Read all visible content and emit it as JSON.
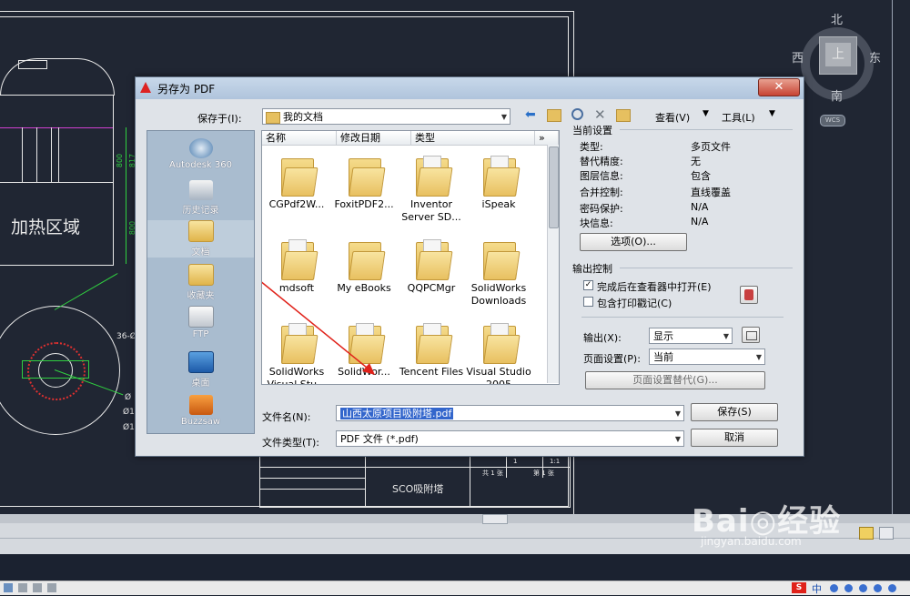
{
  "cad": {
    "heating_zone_label": "加热区域",
    "title_block_text": "SCO吸附塔",
    "dim_labels": [
      "800",
      "817",
      "800"
    ],
    "side_labels": [
      "36-Ø",
      "Ø",
      "Ø1",
      "Ø1"
    ],
    "tb_small": [
      "1",
      "1:1",
      "共 1 张",
      "第 1 张"
    ]
  },
  "compass": {
    "north": "北",
    "south": "南",
    "east": "东",
    "west": "西",
    "center": "上",
    "wcs": "WCS"
  },
  "dialog": {
    "title": "另存为 PDF",
    "close_label": "✕",
    "save_in_label": "保存于(I):",
    "save_in_value": "我的文档",
    "view_label": "查看(V)",
    "tools_label": "工具(L)",
    "columns": [
      "名称",
      "修改日期",
      "类型"
    ],
    "places": [
      "Autodesk 360",
      "历史记录",
      "文档",
      "收藏夹",
      "FTP",
      "桌面",
      "Buzzsaw"
    ],
    "files": [
      "CGPdf2W...",
      "FoxitPDF2...",
      "Inventor Server SD...",
      "iSpeak",
      "mdsoft",
      "My eBooks",
      "QQPCMgr",
      "SolidWorks Downloads",
      "SolidWorks Visual Stu...",
      "SolidWor...",
      "Tencent Files",
      "Visual Studio 2005"
    ],
    "filename_label": "文件名(N):",
    "filename_value": "山西太原项目吸附塔.pdf",
    "filetype_label": "文件类型(T):",
    "filetype_value": "PDF 文件 (*.pdf)",
    "save_button": "保存(S)",
    "cancel_button": "取消",
    "current_settings_title": "当前设置",
    "settings": [
      {
        "key": "类型:",
        "value": "多页文件"
      },
      {
        "key": "替代精度:",
        "value": "无"
      },
      {
        "key": "图层信息:",
        "value": "包含"
      },
      {
        "key": "合并控制:",
        "value": "直线覆盖"
      },
      {
        "key": "密码保护:",
        "value": "N/A"
      },
      {
        "key": "块信息:",
        "value": "N/A"
      }
    ],
    "options_button": "选项(O)...",
    "output_control_title": "输出控制",
    "open_in_viewer_label": "完成后在查看器中打开(E)",
    "open_in_viewer_checked": "✓",
    "include_plot_stamp_label": "包含打印戳记(C)",
    "output_label": "输出(X):",
    "output_value": "显示",
    "page_setup_label": "页面设置(P):",
    "page_setup_value": "当前",
    "page_setup_override_button": "页面设置替代(G)..."
  },
  "watermark": {
    "brand": "Bai◎经验",
    "url": "jingyan.baidu.com"
  },
  "taskbar": {
    "ime": "中"
  },
  "colors": {
    "accent_red": "#e0221a",
    "cad_bg": "#202633",
    "dialog_bg": "#dfe3e8"
  }
}
